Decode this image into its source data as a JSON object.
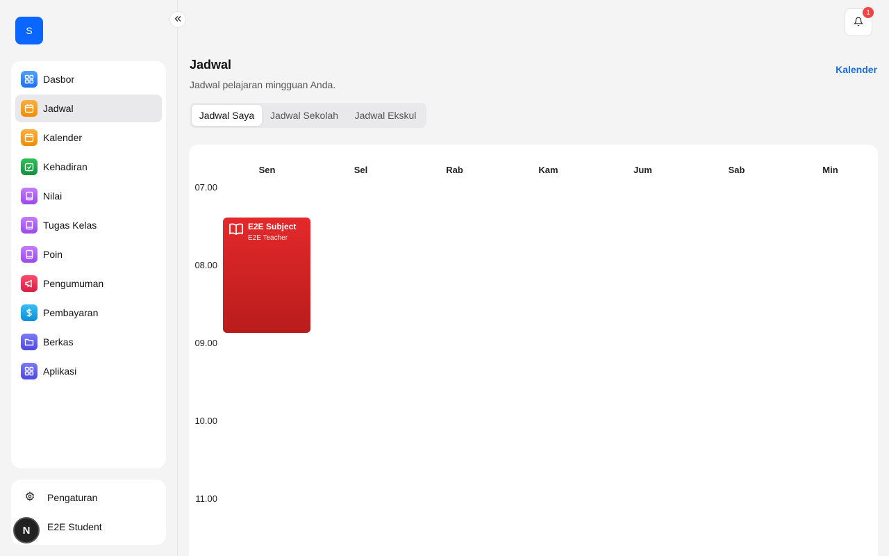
{
  "app": {
    "logo_letter": "S"
  },
  "sidebar": {
    "items": [
      {
        "label": "Dasbor",
        "icon": "dashboard-icon",
        "color": "#3b82f6",
        "active": false
      },
      {
        "label": "Jadwal",
        "icon": "calendar-icon",
        "color": "#f59e0b",
        "active": true
      },
      {
        "label": "Kalender",
        "icon": "calendar-icon",
        "color": "#f59e0b",
        "active": false
      },
      {
        "label": "Kehadiran",
        "icon": "attendance-check-icon",
        "color": "#16a34a",
        "active": false
      },
      {
        "label": "Nilai",
        "icon": "book-icon",
        "color": "#a855f7",
        "active": false
      },
      {
        "label": "Tugas Kelas",
        "icon": "book-icon",
        "color": "#a855f7",
        "active": false
      },
      {
        "label": "Poin",
        "icon": "book-icon",
        "color": "#a855f7",
        "active": false
      },
      {
        "label": "Pengumuman",
        "icon": "megaphone-icon",
        "color": "#e11d48",
        "active": false
      },
      {
        "label": "Pembayaran",
        "icon": "dollar-icon",
        "color": "#0ea5e9",
        "active": false
      },
      {
        "label": "Berkas",
        "icon": "folder-icon",
        "color": "#6366f1",
        "active": false
      },
      {
        "label": "Aplikasi",
        "icon": "apps-grid-icon",
        "color": "#6366f1",
        "active": false
      }
    ],
    "settings_label": "Pengaturan",
    "user_name": "E2E Student",
    "avatar_letter": "N"
  },
  "header": {
    "notification_count": "1"
  },
  "page": {
    "title": "Jadwal",
    "subtitle": "Jadwal pelajaran mingguan Anda.",
    "calendar_link": "Kalender"
  },
  "tabs": [
    {
      "label": "Jadwal Saya",
      "active": true
    },
    {
      "label": "Jadwal Sekolah",
      "active": false
    },
    {
      "label": "Jadwal Ekskul",
      "active": false
    }
  ],
  "schedule": {
    "days": [
      "Sen",
      "Sel",
      "Rab",
      "Kam",
      "Jum",
      "Sab",
      "Min"
    ],
    "times": [
      "07.00",
      "08.00",
      "09.00",
      "10.00",
      "11.00"
    ],
    "events": [
      {
        "subject": "E2E Subject",
        "teacher": "E2E Teacher",
        "day": "Sen",
        "color": "#dc2626"
      }
    ]
  }
}
